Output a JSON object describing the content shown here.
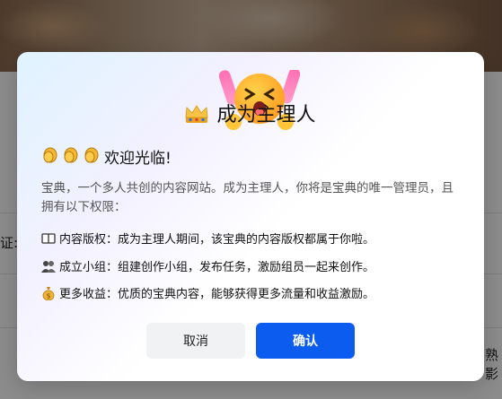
{
  "background": {
    "left_fragment": "证:",
    "right_fragment": "熟影"
  },
  "dialog": {
    "title": "成为主理人",
    "title_icon": "crown-icon",
    "welcome_text": "欢迎光临!",
    "welcome_icon": "clapping-hands-icon",
    "description": "宝典，一个多人共创的内容网站。成为主理人，你将是宝典的唯一管理员，且拥有以下权限：",
    "permissions": [
      {
        "icon": "book-icon",
        "text": "内容版权：成为主理人期间，该宝典的内容版权都属于你啦。"
      },
      {
        "icon": "group-icon",
        "text": "成立小组：组建创作小组，发布任务，激励组员一起来创作。"
      },
      {
        "icon": "money-bag-icon",
        "text": "更多收益：优质的宝典内容，能够获得更多流量和收益激励。"
      }
    ],
    "cancel_label": "取消",
    "confirm_label": "确认",
    "colors": {
      "primary": "#0d5cf0",
      "cancel_bg": "#f1f2f4"
    }
  }
}
